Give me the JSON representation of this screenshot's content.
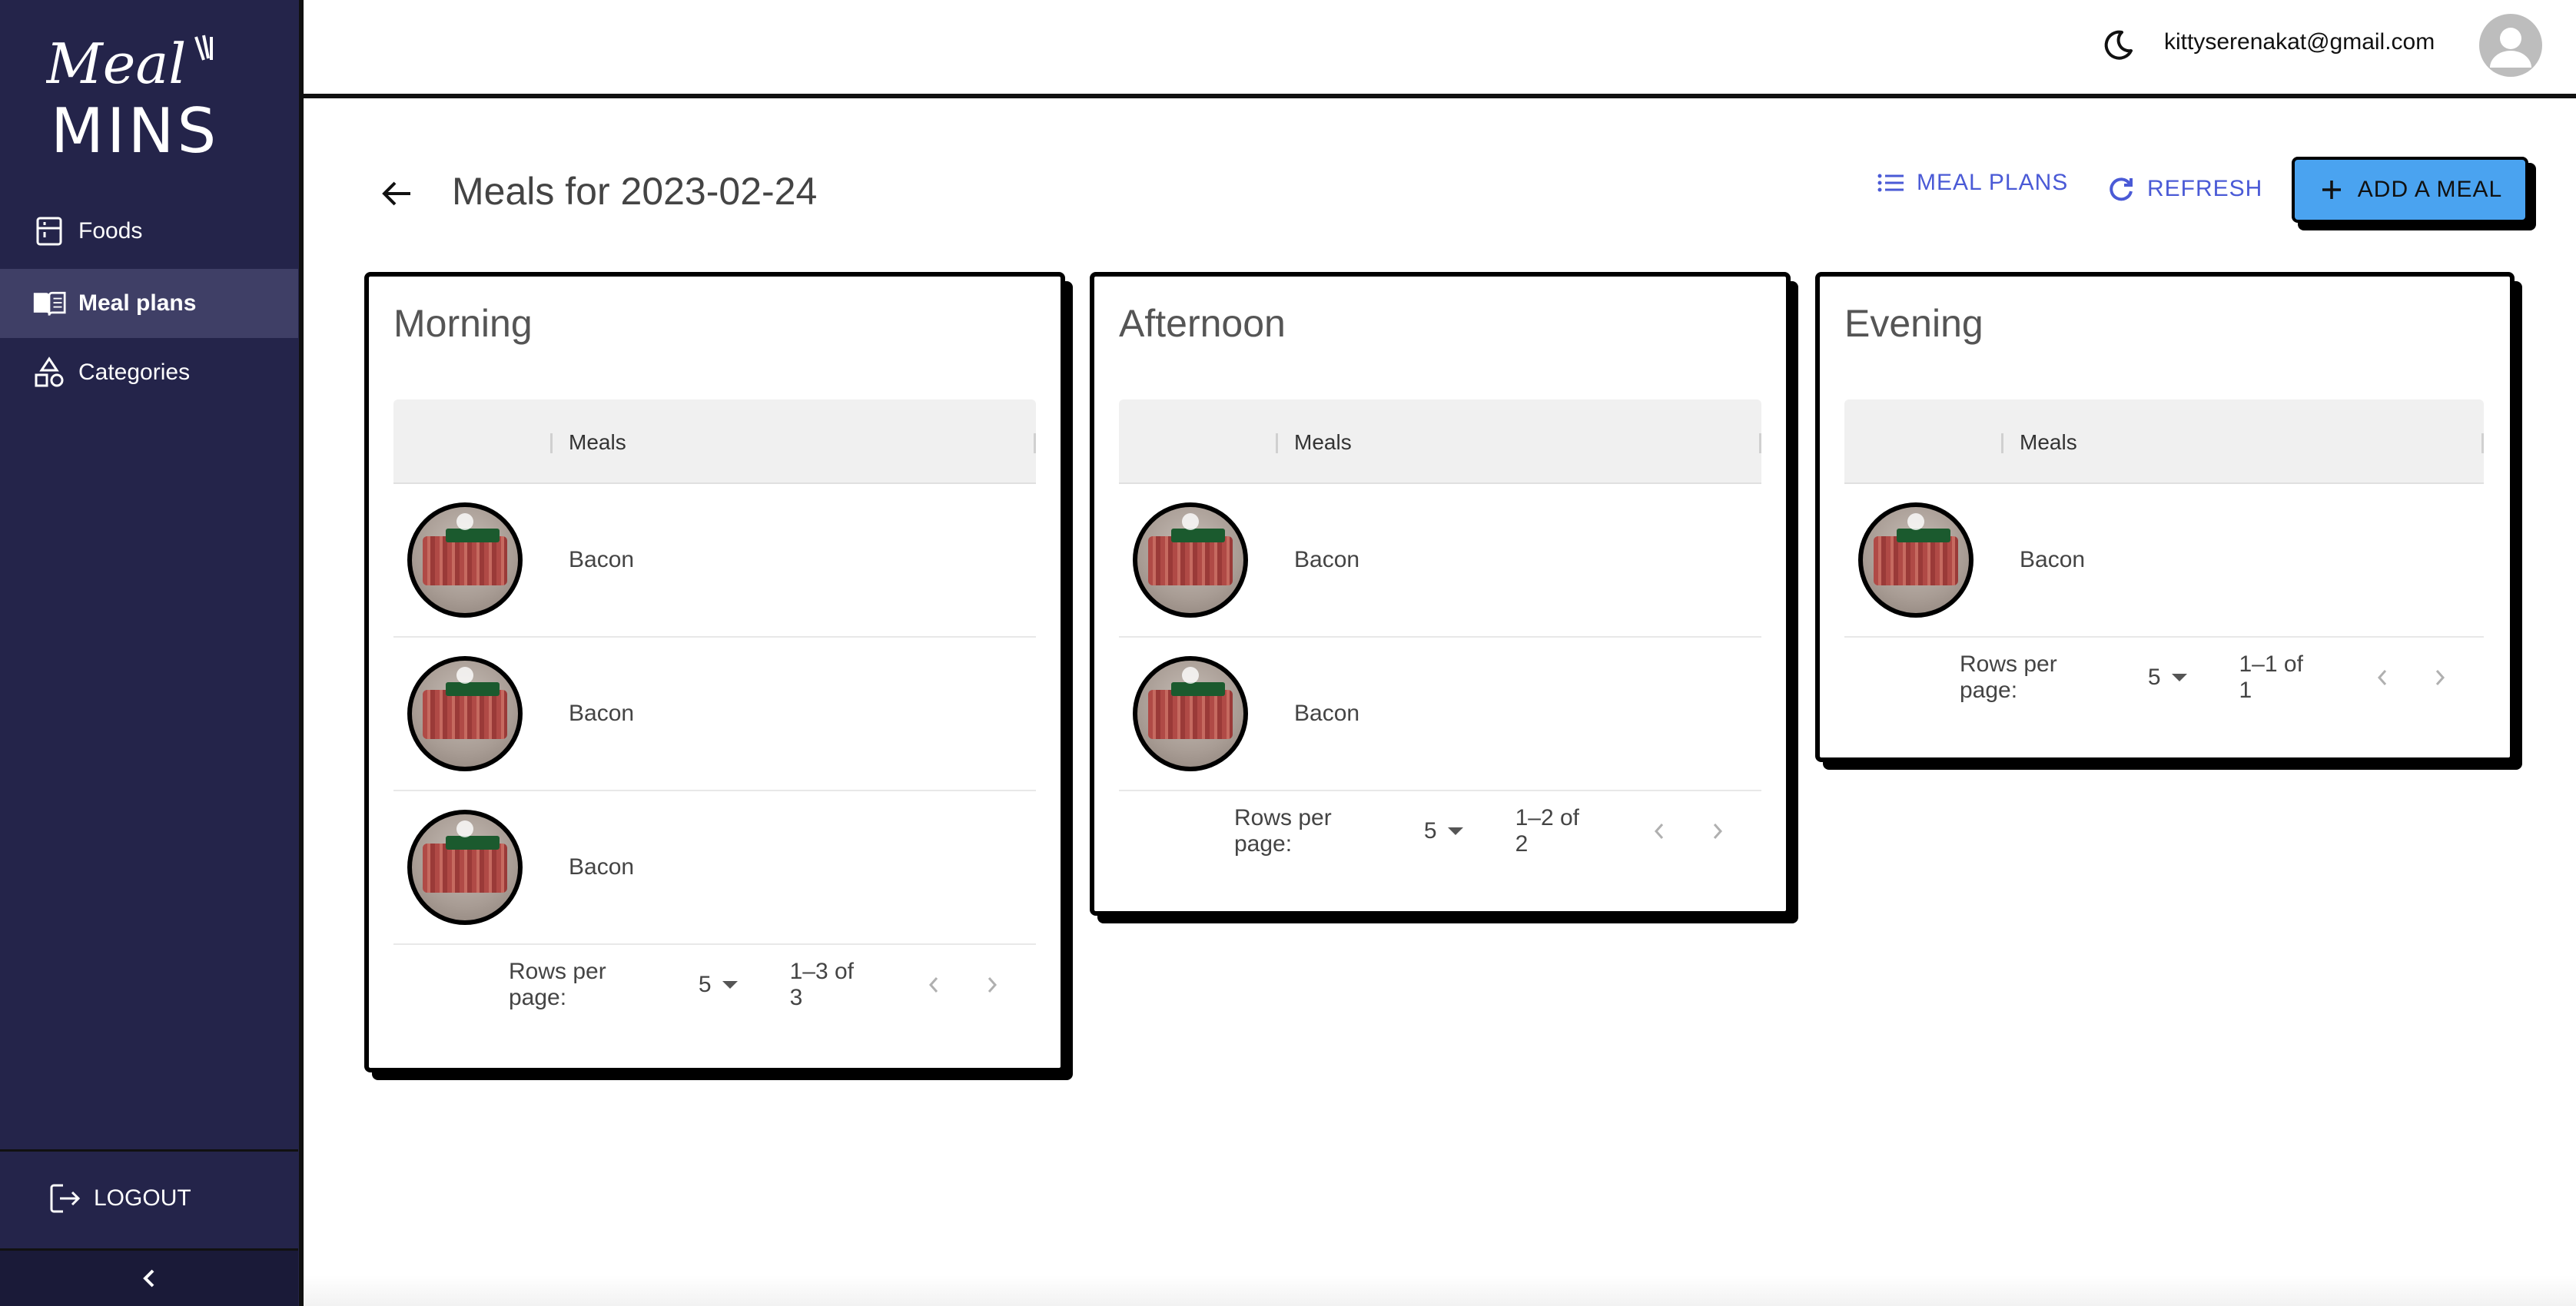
{
  "app": {
    "logo_text": "Meal MINS"
  },
  "sidebar": {
    "items": [
      {
        "label": "Foods",
        "icon": "food-menu-icon",
        "active": false
      },
      {
        "label": "Meal plans",
        "icon": "book-open-icon",
        "active": true
      },
      {
        "label": "Categories",
        "icon": "shapes-icon",
        "active": false
      }
    ],
    "logout_label": "LOGOUT",
    "collapse_icon": "chevron-left-icon"
  },
  "header": {
    "email": "kittyserenakat@gmail.com",
    "theme_icon": "moon-icon",
    "avatar_icon": "user-avatar-icon"
  },
  "page": {
    "title": "Meals for 2023-02-24",
    "actions": {
      "meal_plans_label": "MEAL PLANS",
      "refresh_label": "REFRESH",
      "add_meal_label": "ADD A MEAL"
    },
    "colors": {
      "accent": "#4a5ad6",
      "primary_button": "#4aa3f0",
      "sidebar": "#24244a"
    }
  },
  "cards": [
    {
      "title": "Morning",
      "column_header": "Meals",
      "rows": [
        {
          "name": "Bacon"
        },
        {
          "name": "Bacon"
        },
        {
          "name": "Bacon"
        }
      ],
      "pager": {
        "rows_per_page_label": "Rows per page:",
        "rows_per_page": "5",
        "range": "1–3 of 3"
      }
    },
    {
      "title": "Afternoon",
      "column_header": "Meals",
      "rows": [
        {
          "name": "Bacon"
        },
        {
          "name": "Bacon"
        }
      ],
      "pager": {
        "rows_per_page_label": "Rows per page:",
        "rows_per_page": "5",
        "range": "1–2 of 2"
      }
    },
    {
      "title": "Evening",
      "column_header": "Meals",
      "rows": [
        {
          "name": "Bacon"
        }
      ],
      "pager": {
        "rows_per_page_label": "Rows per page:",
        "rows_per_page": "5",
        "range": "1–1 of 1"
      }
    }
  ]
}
